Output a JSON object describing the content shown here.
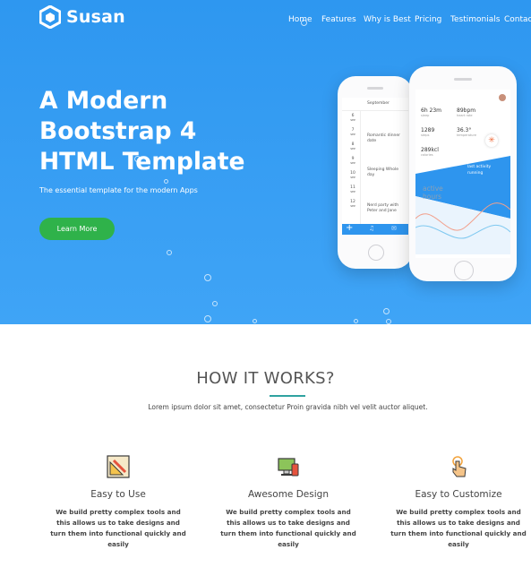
{
  "brand": {
    "name": "Susan"
  },
  "nav": {
    "items": [
      "Home",
      "Features",
      "Why is Best",
      "Pricing",
      "Testimonials",
      "Contact"
    ]
  },
  "hero": {
    "title_line1": "A Modern",
    "title_line2": "Bootstrap 4",
    "title_line3": "HTML Template",
    "subtitle": "The essential template for the modern Apps",
    "button_label": "Learn More"
  },
  "phone_left": {
    "month": "September",
    "entries": [
      {
        "day": "6",
        "dow": "SEP",
        "text": ""
      },
      {
        "day": "7",
        "dow": "SEP",
        "text": ""
      },
      {
        "day": "8",
        "dow": "SEP",
        "text": "Romantic dinner date"
      },
      {
        "day": "9",
        "dow": "SEP",
        "text": ""
      },
      {
        "day": "10",
        "dow": "SEP",
        "text": "Sleeping Whole day"
      },
      {
        "day": "11",
        "dow": "SEP",
        "text": ""
      },
      {
        "day": "12",
        "dow": "SEP",
        "text": "Nerd party with Peter and Jane"
      }
    ]
  },
  "phone_right": {
    "stats": [
      {
        "value": "6h 23m",
        "label": "sleep"
      },
      {
        "value": "89bpm",
        "label": "heart rate"
      },
      {
        "value": "1289",
        "label": "steps"
      },
      {
        "value": "36.3°",
        "label": "temperature"
      },
      {
        "value": "289kcl",
        "label": "calories"
      }
    ],
    "activity_title": "last activity",
    "activity_value": "running",
    "chart_label_1": "active",
    "chart_label_2": "hours"
  },
  "how": {
    "title": "HOW IT WORKS?",
    "subtitle": "Lorem ipsum dolor sit amet, consectetur Proin gravida nibh vel velit auctor aliquet."
  },
  "features": [
    {
      "title": "Easy to Use",
      "desc_l1": "We build pretty complex tools and",
      "desc_l2": "this allows us to take designs and",
      "desc_l3": "turn them into functional quickly and",
      "desc_l4": "easily"
    },
    {
      "title": "Awesome Design",
      "desc_l1": "We build pretty complex tools and",
      "desc_l2": "this allows us to take designs and",
      "desc_l3": "turn them into functional quickly and",
      "desc_l4": "easily"
    },
    {
      "title": "Easy to Customize",
      "desc_l1": "We build pretty complex tools and",
      "desc_l2": "this allows us to take designs and",
      "desc_l3": "turn them into functional quickly and",
      "desc_l4": "easily"
    }
  ],
  "colors": {
    "hero_blue": "#3a9ff3",
    "button_green": "#2fb24a",
    "accent_teal": "#2fa2a0"
  }
}
